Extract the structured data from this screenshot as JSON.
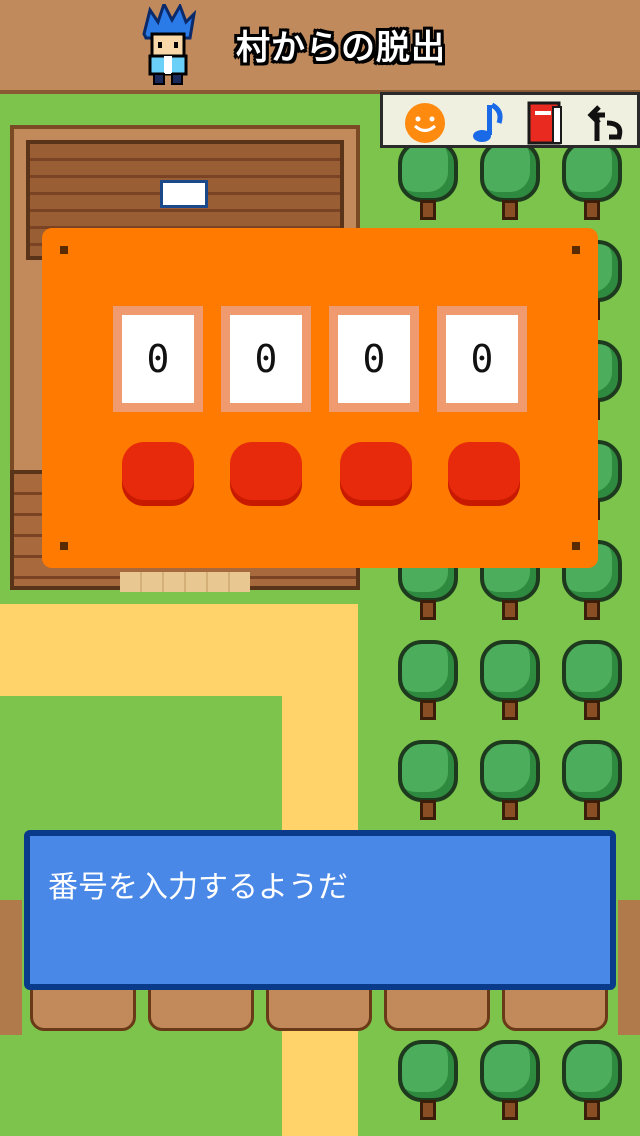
{
  "header": {
    "title": "村からの脱出"
  },
  "toolbar": {
    "items": [
      {
        "name": "hint",
        "icon": "smiley-face-icon"
      },
      {
        "name": "sound",
        "icon": "music-note-icon"
      },
      {
        "name": "book",
        "icon": "book-icon"
      },
      {
        "name": "back",
        "icon": "back-arrow-icon"
      }
    ]
  },
  "lock": {
    "digits": [
      "0",
      "0",
      "0",
      "0"
    ],
    "button_color": "#e82a0c",
    "panel_color": "#ff7a00"
  },
  "dialog": {
    "message": "番号を入力するようだ"
  },
  "colors": {
    "grass": "#7cc44c",
    "path": "#ffd26a",
    "dialog_bg": "#4a88e8",
    "dialog_border": "#0a3a8a"
  }
}
